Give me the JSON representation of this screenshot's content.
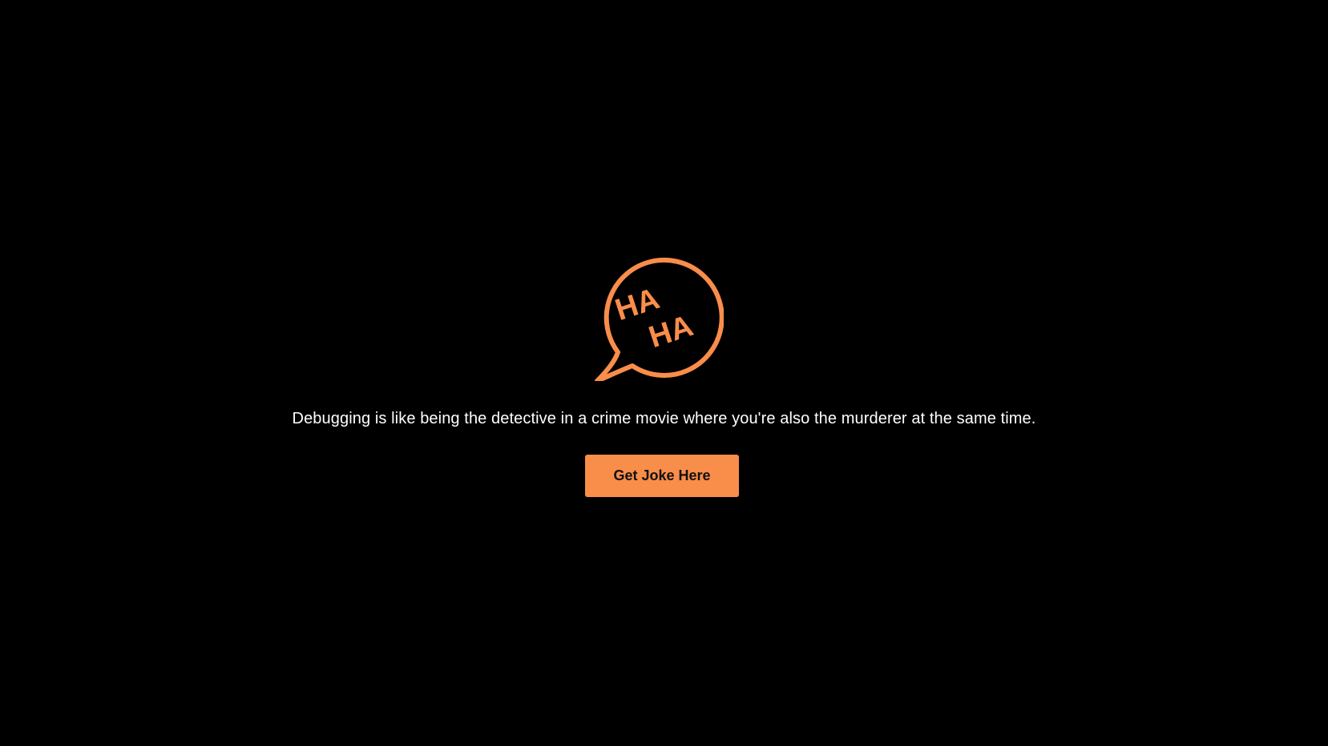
{
  "logo": {
    "icon": "haha-speech-bubble-icon",
    "line1": "HA",
    "line2": "HA",
    "color": "#f98d4a"
  },
  "joke": {
    "text": "Debugging is like being the detective in a crime movie where you're also the murderer at the same time."
  },
  "button": {
    "label": "Get Joke Here",
    "color": "#f98d4a"
  },
  "background": "#000000"
}
